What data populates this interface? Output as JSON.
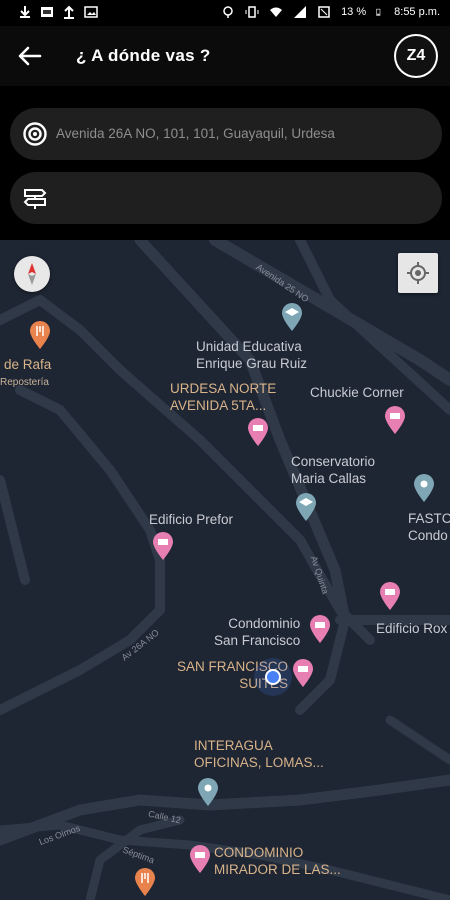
{
  "status_bar": {
    "left_icons": [
      "download-icon",
      "image-icon",
      "upload-icon",
      "gallery-icon"
    ],
    "battery": "13 %",
    "time": "8:55 p.m."
  },
  "app_bar": {
    "title": "¿ A dónde vas ?",
    "logo_text": "Z4"
  },
  "search": {
    "origin_value": "Avenida 26A NO, 101, 101, Guayaquil, Urdesa",
    "destination_value": ""
  },
  "map": {
    "pois": [
      {
        "name": "de Rafa",
        "category": "Repostería"
      },
      {
        "name": "Unidad Educativa\nEnrique Grau Ruiz"
      },
      {
        "name": "URDESA NORTE\nAVENIDA 5TA..."
      },
      {
        "name": "Chuckie Corner"
      },
      {
        "name": "Conservatorio\nMaria Callas"
      },
      {
        "name": "Edificio Prefor"
      },
      {
        "name": "FASTC\nCondo"
      },
      {
        "name": "Condominio\nSan Francisco"
      },
      {
        "name": "Edificio Rox"
      },
      {
        "name": "SAN FRANCISCO\nSUITES"
      },
      {
        "name": "INTERAGUA\nOFICINAS, LOMAS..."
      },
      {
        "name": "CONDOMINIO\nMIRADOR DE LAS..."
      }
    ],
    "streets": [
      "Avenida 25 NO",
      "Av 26A NO",
      "Av Quinta",
      "Calle 12",
      "Los Olmos",
      "Séptima"
    ],
    "colors": {
      "background": "#1e2533",
      "road": "#2f3948",
      "poi_text": "#d9b48a",
      "location": "#4a80f5"
    }
  }
}
